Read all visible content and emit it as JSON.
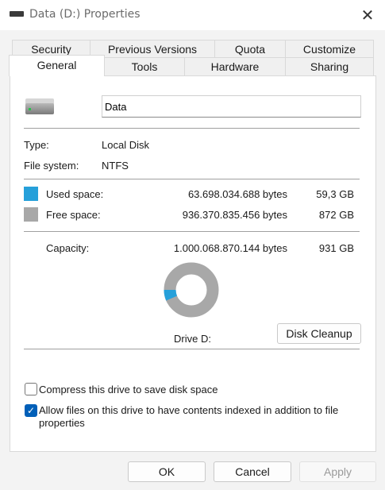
{
  "window": {
    "title": "Data (D:) Properties",
    "close_glyph": "✕"
  },
  "tabs": {
    "row1": [
      "Security",
      "Previous Versions",
      "Quota",
      "Customize"
    ],
    "row2": [
      "General",
      "Tools",
      "Hardware",
      "Sharing"
    ],
    "selected": "General"
  },
  "general": {
    "drive_name": "Data",
    "type_label": "Type:",
    "type_value": "Local Disk",
    "fs_label": "File system:",
    "fs_value": "NTFS",
    "used_label": "Used space:",
    "used_bytes": "63.698.034.688 bytes",
    "used_size": "59,3 GB",
    "free_label": "Free space:",
    "free_bytes": "936.370.835.456 bytes",
    "free_size": "872 GB",
    "capacity_label": "Capacity:",
    "capacity_bytes": "1.000.068.870.144 bytes",
    "capacity_size": "931 GB",
    "drive_label": "Drive D:",
    "cleanup_button": "Disk Cleanup",
    "used_fraction": 0.0637,
    "used_color": "#26a0da",
    "free_color": "#a8a8a8",
    "compress_label": "Compress this drive to save disk space",
    "compress_checked": false,
    "index_label_line1": "Allow files on this drive to have contents indexed in addition to file",
    "index_label_line2": "properties",
    "index_checked": true
  },
  "footer": {
    "ok": "OK",
    "cancel": "Cancel",
    "apply": "Apply"
  }
}
